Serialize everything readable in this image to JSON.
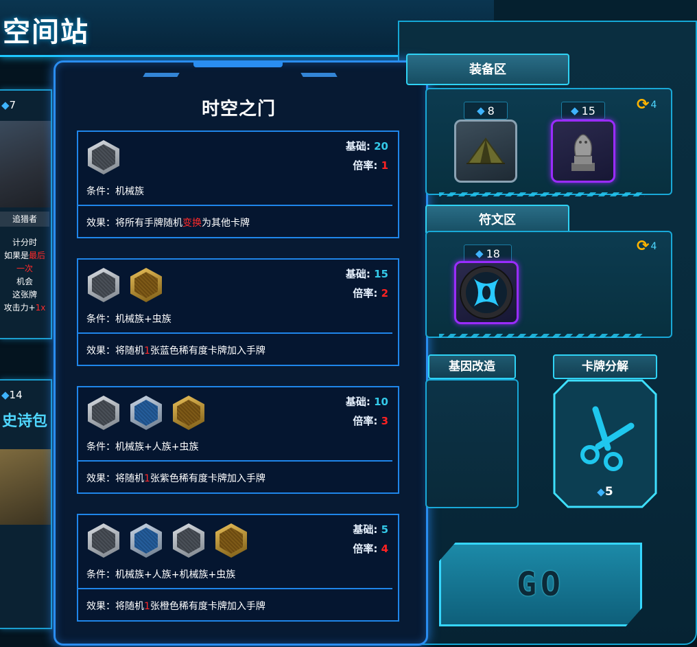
{
  "page": {
    "title": "空间站"
  },
  "left_cards": [
    {
      "gem_count": "7",
      "name": "追猎者",
      "desc_lines": [
        "计分时",
        "如果是",
        "最后一次",
        "机会",
        "这张牌",
        "攻击力+",
        "1x"
      ]
    },
    {
      "gem_count": "14",
      "name": "史诗包"
    }
  ],
  "modal": {
    "title": "时空之门",
    "base_label": "基础:",
    "mult_label": "倍率:",
    "cond_label": "条件：",
    "effect_label": "效果：",
    "cards": [
      {
        "icons": [
          "mech"
        ],
        "base": "20",
        "mult": "1",
        "condition": "机械族",
        "effect": [
          {
            "t": "将所有手牌随机"
          },
          {
            "t": "变换",
            "hl": true
          },
          {
            "t": "为其他卡牌"
          }
        ]
      },
      {
        "icons": [
          "mech",
          "bug"
        ],
        "base": "15",
        "mult": "2",
        "condition": "机械族+虫族",
        "effect": [
          {
            "t": "将随机"
          },
          {
            "t": "1",
            "hl": true
          },
          {
            "t": "张蓝色稀有度卡牌加入手牌"
          }
        ]
      },
      {
        "icons": [
          "mech",
          "human",
          "bug"
        ],
        "base": "10",
        "mult": "3",
        "condition": "机械族+人族+虫族",
        "effect": [
          {
            "t": "将随机"
          },
          {
            "t": "1",
            "hl": true
          },
          {
            "t": "张紫色稀有度卡牌加入手牌"
          }
        ]
      },
      {
        "icons": [
          "mech",
          "human",
          "mech",
          "bug"
        ],
        "base": "5",
        "mult": "4",
        "condition": "机械族+人族+机械族+虫族",
        "effect": [
          {
            "t": "将随机"
          },
          {
            "t": "1",
            "hl": true
          },
          {
            "t": "张橙色稀有度卡牌加入手牌"
          }
        ]
      }
    ]
  },
  "equipment": {
    "label": "装备区",
    "refresh_count": "4",
    "items": [
      {
        "price": "8",
        "icon": "tent-icon",
        "rarity": "gray"
      },
      {
        "price": "15",
        "icon": "statue-icon",
        "rarity": "purple"
      }
    ]
  },
  "runes": {
    "label": "符文区",
    "refresh_count": "4",
    "items": [
      {
        "price": "18",
        "icon": "rune-icon",
        "rarity": "purple"
      }
    ]
  },
  "gene": {
    "label": "基因改造"
  },
  "decompose": {
    "label": "卡牌分解",
    "price": "5"
  },
  "go_button": {
    "label": "GO"
  },
  "colors": {
    "accent": "#2a8df0",
    "base_num": "#34c9e8",
    "mult_num": "#ff2222",
    "highlight": "#ff2a2a",
    "purple": "#9a2cff"
  }
}
